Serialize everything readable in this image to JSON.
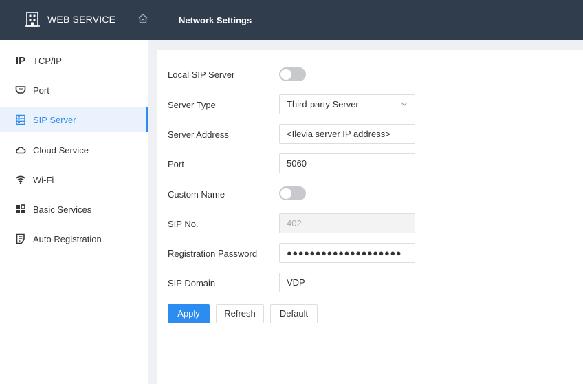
{
  "header": {
    "brand": "WEB SERVICE",
    "page_title": "Network Settings"
  },
  "sidebar": {
    "items": [
      {
        "label": "TCP/IP",
        "icon": "ip-icon",
        "active": false
      },
      {
        "label": "Port",
        "icon": "port-icon",
        "active": false
      },
      {
        "label": "SIP Server",
        "icon": "server-icon",
        "active": true
      },
      {
        "label": "Cloud Service",
        "icon": "cloud-icon",
        "active": false
      },
      {
        "label": "Wi-Fi",
        "icon": "wifi-icon",
        "active": false
      },
      {
        "label": "Basic Services",
        "icon": "grid-icon",
        "active": false
      },
      {
        "label": "Auto Registration",
        "icon": "registration-icon",
        "active": false
      }
    ],
    "ip_glyph": "IP"
  },
  "form": {
    "local_sip_server": {
      "label": "Local SIP Server",
      "enabled": false
    },
    "server_type": {
      "label": "Server Type",
      "value": "Third-party Server"
    },
    "server_address": {
      "label": "Server Address",
      "value": "<Ilevia server IP address>"
    },
    "port": {
      "label": "Port",
      "value": "5060"
    },
    "custom_name": {
      "label": "Custom Name",
      "enabled": false
    },
    "sip_no": {
      "label": "SIP No.",
      "value": "402"
    },
    "registration_password": {
      "label": "Registration Password",
      "value": "●●●●●●●●●●●●●●●●●●●●"
    },
    "sip_domain": {
      "label": "SIP Domain",
      "value": "VDP"
    }
  },
  "buttons": {
    "apply": "Apply",
    "refresh": "Refresh",
    "default": "Default"
  },
  "colors": {
    "header_bg": "#2f3d4d",
    "accent": "#2d8cf0",
    "active_bg": "#eaf3fd",
    "toggle_off": "#c8c9cc"
  }
}
